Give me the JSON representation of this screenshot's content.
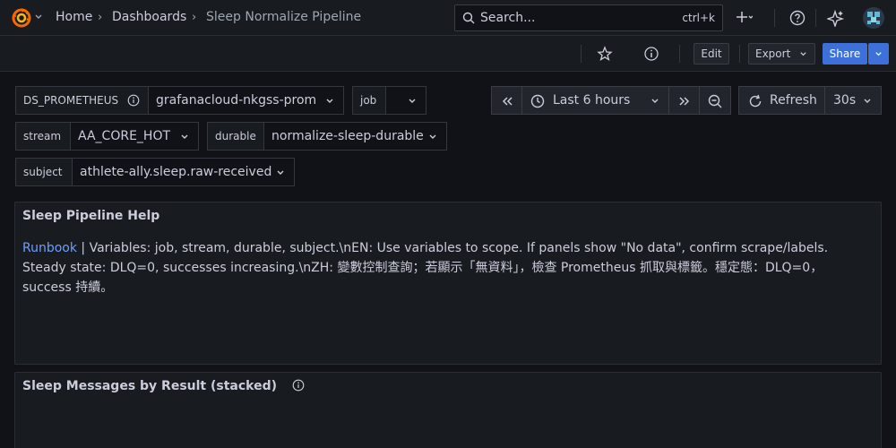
{
  "nav": {
    "breadcrumbs": [
      "Home",
      "Dashboards",
      "Sleep Normalize Pipeline"
    ],
    "search_placeholder": "Search...",
    "search_shortcut": "ctrl+k"
  },
  "toolbar": {
    "edit_label": "Edit",
    "export_label": "Export",
    "share_label": "Share"
  },
  "variables": [
    {
      "label": "DS_PROMETHEUS",
      "value": "grafanacloud-nkgss-prom",
      "has_info": true
    },
    {
      "label": "job",
      "value": ""
    },
    {
      "label": "stream",
      "value": "AA_CORE_HOT"
    },
    {
      "label": "durable",
      "value": "normalize-sleep-durable"
    },
    {
      "label": "subject",
      "value": "athlete-ally.sleep.raw-received"
    }
  ],
  "timepicker": {
    "range": "Last 6 hours",
    "refresh_label": "Refresh",
    "refresh_interval": "30s"
  },
  "panels": [
    {
      "title": "Sleep Pipeline Help",
      "link_text": "Runbook",
      "separator": " | ",
      "body": "Variables: job, stream, durable, subject.\\nEN: Use variables to scope. If panels show \"No data\", confirm scrape/labels. Steady state: DLQ=0, successes increasing.\\nZH: 變數控制查詢；若顯示「無資料」，檢查 Prometheus 抓取與標籤。穩定態：DLQ=0，success 持續。"
    },
    {
      "title": "Sleep Messages by Result (stacked)"
    }
  ],
  "colors": {
    "background": "#111217",
    "panel": "#181b1f",
    "primary_button": "#3d71d9",
    "link": "#6e9fff"
  },
  "icons": [
    "grafana-logo-icon",
    "search-icon",
    "plus-icon",
    "help-icon",
    "ai-sparkle-icon",
    "avatar",
    "star-icon",
    "info-icon",
    "clock-icon",
    "zoom-out-icon",
    "refresh-icon"
  ]
}
